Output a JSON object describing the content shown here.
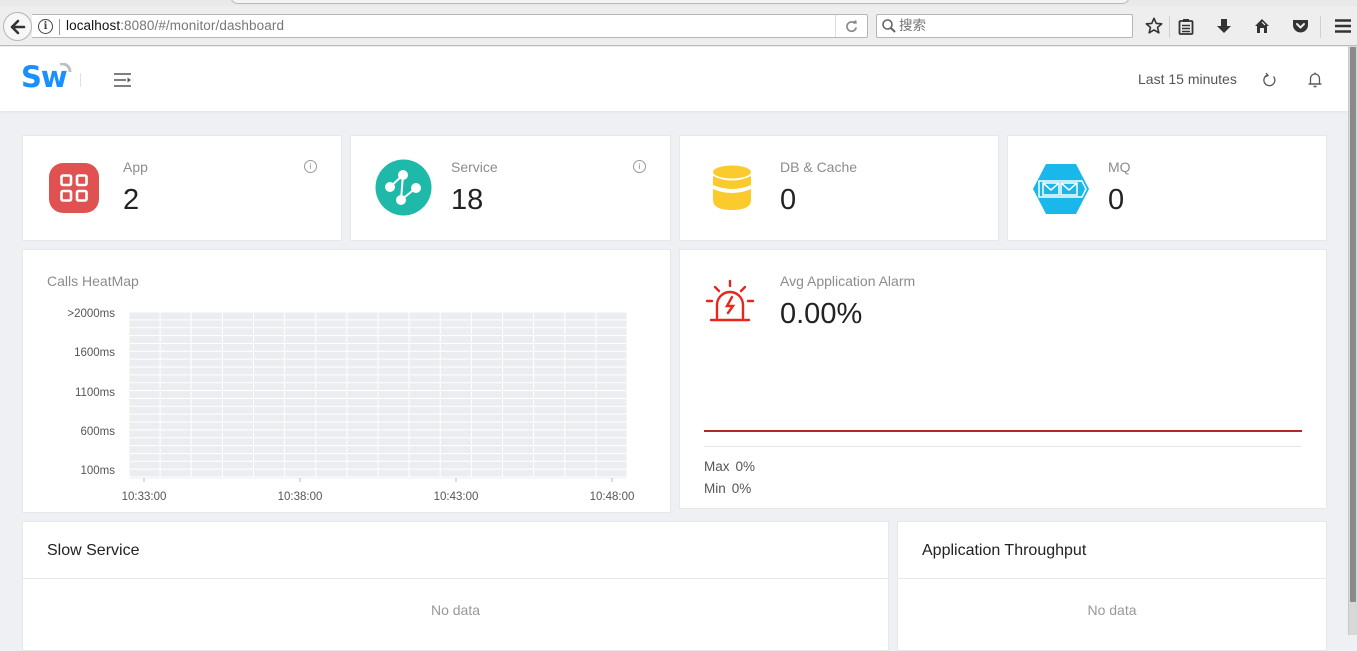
{
  "browser": {
    "url_host": "localhost",
    "url_rest": ":8080/#/monitor/dashboard",
    "search_placeholder": "搜索"
  },
  "header": {
    "logo_text": "Sw",
    "time_range": "Last 15 minutes"
  },
  "stats": [
    {
      "label": "App",
      "value": "2",
      "icon": "apps-grid-icon",
      "color": "#e05252",
      "has_info": true
    },
    {
      "label": "Service",
      "value": "18",
      "icon": "service-topology-icon",
      "color": "#1fb9aa",
      "has_info": true
    },
    {
      "label": "DB & Cache",
      "value": "0",
      "icon": "database-icon",
      "color": "#fbcb2d",
      "has_info": false
    },
    {
      "label": "MQ",
      "value": "0",
      "icon": "message-queue-icon",
      "color": "#1ab7ea",
      "has_info": false
    }
  ],
  "info_glyph": "i",
  "heatmap": {
    "title": "Calls HeatMap"
  },
  "chart_data": {
    "type": "heatmap",
    "title": "Calls HeatMap",
    "xlabel": "",
    "ylabel": "",
    "x_ticks": [
      "10:33:00",
      "10:38:00",
      "10:43:00",
      "10:48:00"
    ],
    "y_ticks": [
      "100ms",
      "600ms",
      "1100ms",
      "1600ms",
      ">2000ms"
    ],
    "columns": 16,
    "rows": 21,
    "x_range": [
      "10:32:30",
      "10:48:00"
    ],
    "y_range": [
      "100ms",
      ">2000ms"
    ],
    "values": "all cells empty (0 calls)",
    "cell_color": "#ebedf1"
  },
  "alarm": {
    "label": "Avg Application Alarm",
    "value": "0.00%",
    "max_label": "Max",
    "max_value": "0%",
    "min_label": "Min",
    "min_value": "0%",
    "line_color": "#b0282b",
    "icon_color": "#e8261b"
  },
  "slow_service": {
    "title": "Slow Service",
    "empty_text": "No data"
  },
  "throughput": {
    "title": "Application Throughput",
    "empty_text": "No data"
  }
}
